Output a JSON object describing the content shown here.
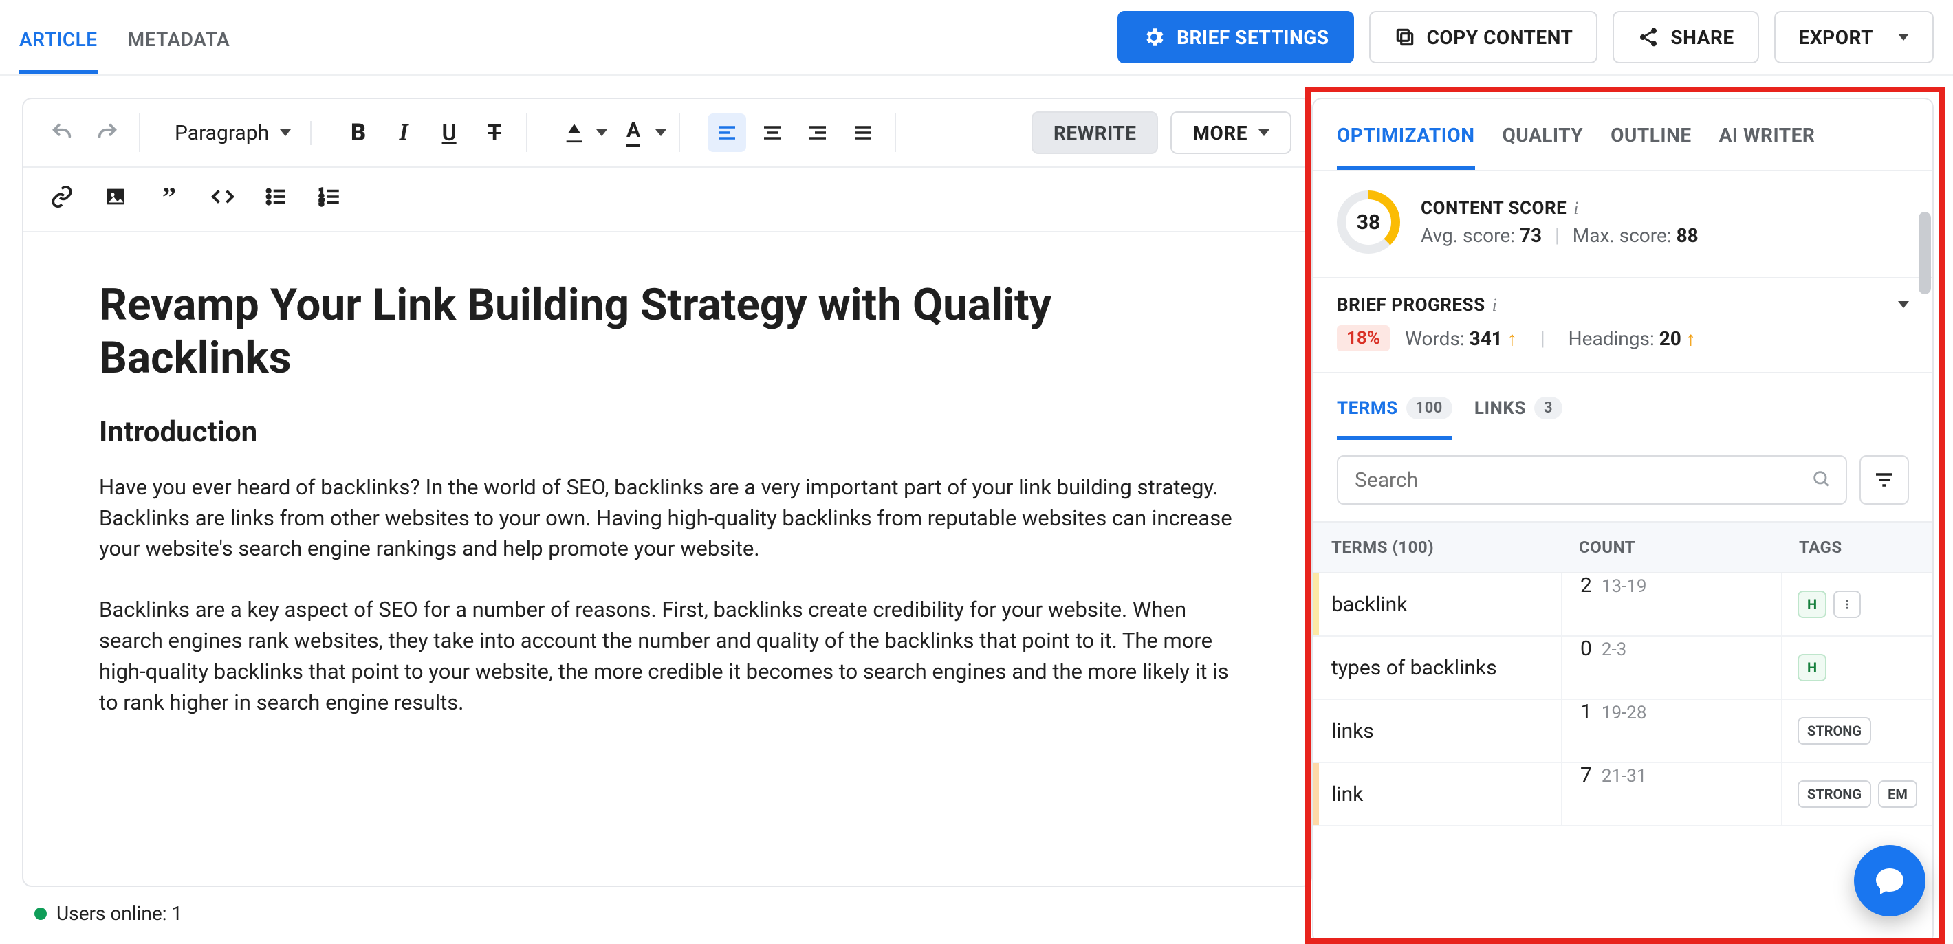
{
  "topTabs": {
    "article": "ARTICLE",
    "metadata": "METADATA"
  },
  "actions": {
    "briefSettings": "BRIEF SETTINGS",
    "copyContent": "COPY CONTENT",
    "share": "SHARE",
    "export": "EXPORT"
  },
  "toolbar": {
    "paragraph": "Paragraph",
    "rewrite": "REWRITE",
    "more": "MORE"
  },
  "article": {
    "title": "Revamp Your Link Building Strategy with Quality Backlinks",
    "h2": "Introduction",
    "p1": "Have you ever heard of backlinks? In the world of SEO, backlinks are a very important part of your link building strategy. Backlinks are links from other websites to your own. Having high-quality backlinks from reputable websites can increase your website's search engine rankings and help promote your website.",
    "p2": "Backlinks are a key aspect of SEO for a number of reasons. First, backlinks create credibility for your website. When search engines rank websites, they take into account the number and quality of the backlinks that point to it. The more high-quality backlinks that point to your website, the more credible it becomes to search engines and the more likely it is to rank higher in search engine results."
  },
  "status": {
    "usersOnline": "Users online: 1"
  },
  "side": {
    "tabs": {
      "optimization": "OPTIMIZATION",
      "quality": "QUALITY",
      "outline": "OUTLINE",
      "aiWriter": "AI WRITER"
    },
    "score": {
      "label": "CONTENT SCORE",
      "value": "38",
      "avgLabel": "Avg. score:",
      "avgValue": "73",
      "maxLabel": "Max. score:",
      "maxValue": "88"
    },
    "progress": {
      "label": "BRIEF PROGRESS",
      "pct": "18%",
      "wordsLabel": "Words:",
      "wordsValue": "341",
      "headingsLabel": "Headings:",
      "headingsValue": "20"
    },
    "termsTab": {
      "terms": "TERMS",
      "termsCount": "100",
      "links": "LINKS",
      "linksCount": "3"
    },
    "search": {
      "placeholder": "Search"
    },
    "table": {
      "head": {
        "terms": "TERMS  (100)",
        "count": "COUNT",
        "tags": "TAGS"
      },
      "rows": [
        {
          "term": "backlink",
          "count": "2",
          "range": "13-19",
          "tags": [
            "H"
          ],
          "dots": true,
          "bar": "y"
        },
        {
          "term": "types of backlinks",
          "count": "0",
          "range": "2-3",
          "tags": [
            "H"
          ],
          "dots": false,
          "bar": ""
        },
        {
          "term": "links",
          "count": "1",
          "range": "19-28",
          "tags": [
            "STRONG"
          ],
          "dots": false,
          "bar": ""
        },
        {
          "term": "link",
          "count": "7",
          "range": "21-31",
          "tags": [
            "STRONG",
            "EM"
          ],
          "dots": false,
          "bar": "o"
        }
      ]
    }
  }
}
